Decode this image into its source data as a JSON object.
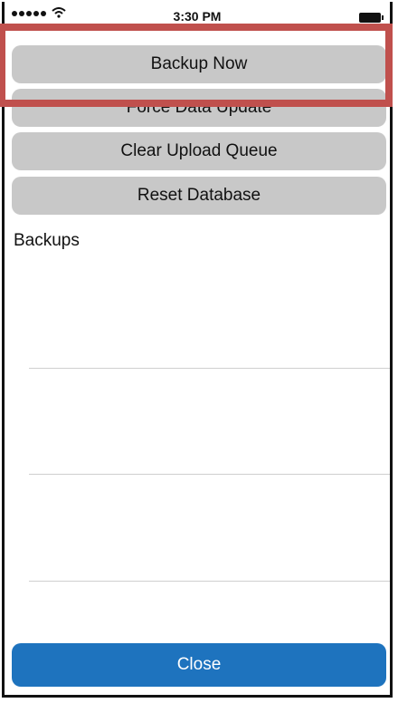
{
  "status_bar": {
    "time": "3:30 PM",
    "signal_icon": "signal-dots-icon",
    "wifi_icon": "wifi-icon",
    "battery_icon": "battery-icon"
  },
  "actions": {
    "backup_now": "Backup Now",
    "force_data_update": "Force Data Update",
    "clear_upload_queue": "Clear Upload Queue",
    "reset_database": "Reset Database"
  },
  "backups": {
    "title": "Backups"
  },
  "footer": {
    "close_label": "Close"
  },
  "colors": {
    "button_gray": "#c8c8c8",
    "close_blue": "#1e73be",
    "highlight_red": "#c0504d"
  }
}
